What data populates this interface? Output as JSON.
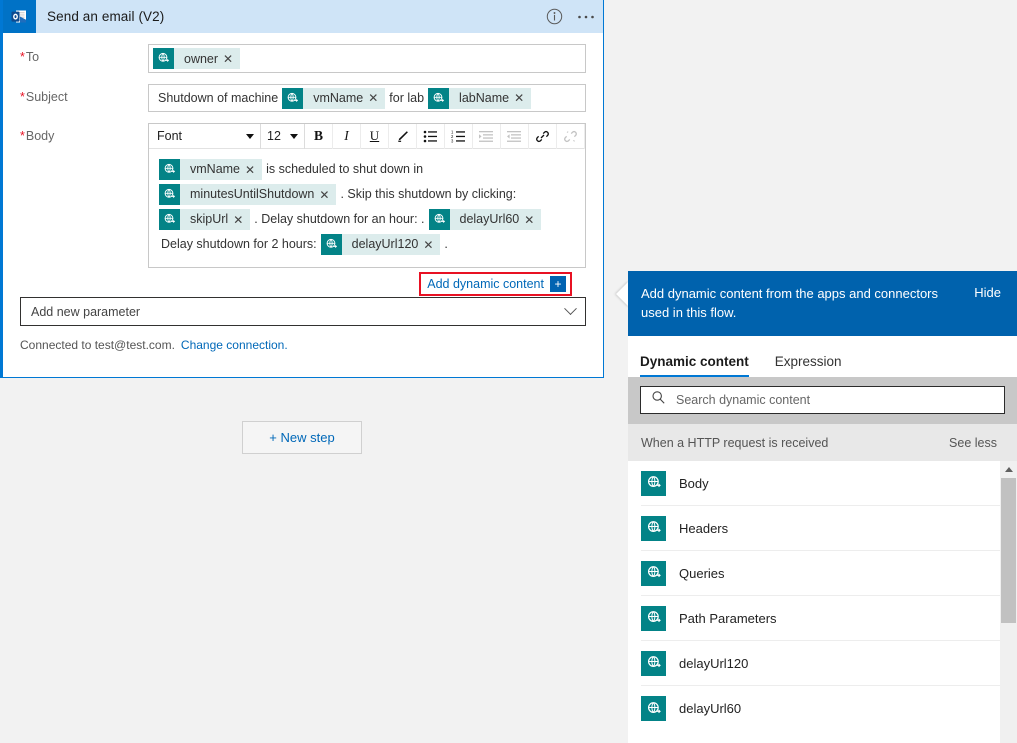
{
  "card": {
    "title": "Send an email (V2)",
    "app_icon": "outlook-icon",
    "info_icon": "info-icon",
    "more_icon": "ellipsis-icon",
    "fields": {
      "to": {
        "label": "To",
        "required_marker": "*",
        "tokens": [
          {
            "label": "owner",
            "icon": "dynamic-content-icon",
            "remove": "✕"
          }
        ]
      },
      "subject": {
        "label": "Subject",
        "required_marker": "*",
        "parts": [
          {
            "type": "text",
            "value": "Shutdown of machine"
          },
          {
            "type": "token",
            "label": "vmName",
            "icon": "dynamic-content-icon",
            "remove": "✕"
          },
          {
            "type": "text",
            "value": "for lab"
          },
          {
            "type": "token",
            "label": "labName",
            "icon": "dynamic-content-icon",
            "remove": "✕"
          }
        ]
      },
      "body": {
        "label": "Body",
        "required_marker": "*",
        "toolbar": {
          "font_label": "Font",
          "size_label": "12",
          "buttons": [
            {
              "name": "bold-icon",
              "glyph": "B",
              "disabled": false
            },
            {
              "name": "italic-icon",
              "glyph": "I",
              "disabled": false
            },
            {
              "name": "underline-icon",
              "glyph": "U",
              "disabled": false
            },
            {
              "name": "highlight-pen-icon",
              "glyph": "",
              "disabled": false
            },
            {
              "name": "bulleted-list-icon",
              "glyph": "",
              "disabled": false
            },
            {
              "name": "numbered-list-icon",
              "glyph": "",
              "disabled": false
            },
            {
              "name": "indent-increase-icon",
              "glyph": "",
              "disabled": true
            },
            {
              "name": "indent-decrease-icon",
              "glyph": "",
              "disabled": true
            },
            {
              "name": "insert-link-icon",
              "glyph": "",
              "disabled": false
            },
            {
              "name": "remove-link-icon",
              "glyph": "",
              "disabled": true
            }
          ]
        },
        "content": [
          {
            "type": "token",
            "label": "vmName",
            "icon": "dynamic-content-icon",
            "remove": "✕"
          },
          {
            "type": "text",
            "value": "is scheduled to shut down in"
          },
          {
            "type": "token",
            "label": "minutesUntilShutdown",
            "icon": "dynamic-content-icon",
            "remove": "✕"
          },
          {
            "type": "text",
            "value": ". Skip this shutdown by clicking:"
          },
          {
            "type": "token",
            "label": "skipUrl",
            "icon": "dynamic-content-icon",
            "remove": "✕"
          },
          {
            "type": "text",
            "value": ". Delay shutdown for an hour: ."
          },
          {
            "type": "token",
            "label": "delayUrl60",
            "icon": "dynamic-content-icon",
            "remove": "✕"
          },
          {
            "type": "text",
            "value": "Delay shutdown for 2 hours:"
          },
          {
            "type": "token",
            "label": "delayUrl120",
            "icon": "dynamic-content-icon",
            "remove": "✕"
          },
          {
            "type": "text",
            "value": "."
          }
        ],
        "add_dynamic_content": {
          "label": "Add dynamic content",
          "plus_glyph": "+",
          "highlight_color": "#e81123"
        }
      }
    },
    "add_new_parameter": "Add new parameter",
    "connection": {
      "text": "Connected to test@test.com.",
      "change_link": "Change connection."
    }
  },
  "canvas": {
    "new_step_label": "+ New step"
  },
  "flyout": {
    "header_text": "Add dynamic content from the apps and connectors used in this flow.",
    "hide_label": "Hide",
    "header_color": "#0062ad",
    "tabs": [
      {
        "label": "Dynamic content",
        "active": true
      },
      {
        "label": "Expression",
        "active": false
      }
    ],
    "search": {
      "placeholder": "Search dynamic content",
      "icon": "search-icon",
      "value": ""
    },
    "group": {
      "title": "When a HTTP request is received",
      "toggle_label": "See less"
    },
    "items": [
      {
        "label": "Body",
        "icon": "dynamic-content-icon"
      },
      {
        "label": "Headers",
        "icon": "dynamic-content-icon"
      },
      {
        "label": "Queries",
        "icon": "dynamic-content-icon"
      },
      {
        "label": "Path Parameters",
        "icon": "dynamic-content-icon"
      },
      {
        "label": "delayUrl120",
        "icon": "dynamic-content-icon"
      },
      {
        "label": "delayUrl60",
        "icon": "dynamic-content-icon"
      }
    ]
  },
  "colors": {
    "accent": "#0078d4",
    "token_icon": "#038387",
    "token_bg": "#dcecec",
    "panel_header": "#0062ad",
    "highlight": "#e81123"
  }
}
